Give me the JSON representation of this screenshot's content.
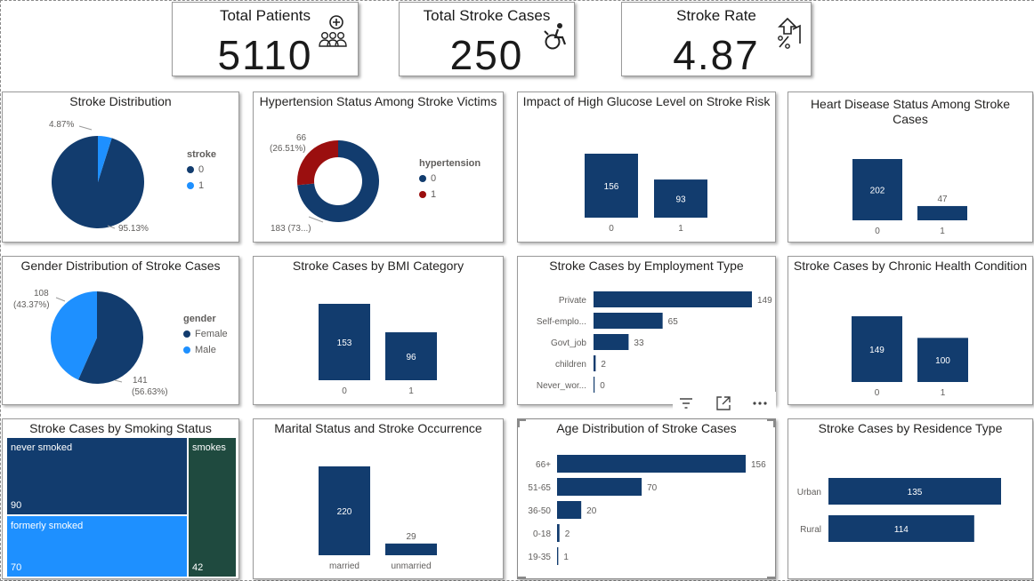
{
  "kpis": [
    {
      "title": "Total Patients",
      "value": "5110",
      "icon": "hospital-patients-icon"
    },
    {
      "title": "Total Stroke Cases",
      "value": "250",
      "icon": "wheelchair-icon"
    },
    {
      "title": "Stroke Rate",
      "value": "4.87",
      "icon": "percent-arrow-up-icon"
    }
  ],
  "colors": {
    "navy": "#123c6e",
    "light_blue": "#1e90ff",
    "dark_red": "#9b0f0f",
    "dark_green": "#1f4a3f"
  },
  "toolbar": {
    "icons": [
      "filter-icon",
      "focus-mode-icon",
      "more-options-icon"
    ]
  },
  "chart_data": [
    {
      "id": "stroke_distribution",
      "type": "pie",
      "title": "Stroke Distribution",
      "legend_title": "stroke",
      "categories": [
        "0",
        "1"
      ],
      "values": [
        95.13,
        4.87
      ],
      "labels": [
        "95.13%",
        "4.87%"
      ],
      "colors": [
        "#123c6e",
        "#1e90ff"
      ]
    },
    {
      "id": "hypertension",
      "type": "pie",
      "donut": true,
      "title": "Hypertension Status Among Stroke Victims",
      "legend_title": "hypertension",
      "categories": [
        "0",
        "1"
      ],
      "values": [
        183,
        66
      ],
      "labels": [
        "183 (73...)",
        "66",
        "(26.51%)"
      ],
      "colors": [
        "#123c6e",
        "#9b0f0f"
      ]
    },
    {
      "id": "glucose",
      "type": "bar",
      "title": "Impact of High Glucose Level on Stroke Risk",
      "categories": [
        "0",
        "1"
      ],
      "values": [
        156,
        93
      ]
    },
    {
      "id": "heart_disease",
      "type": "bar",
      "title": "Heart Disease Status Among Stroke Cases",
      "categories": [
        "0",
        "1"
      ],
      "values": [
        202,
        47
      ]
    },
    {
      "id": "gender",
      "type": "pie",
      "title": "Gender Distribution of Stroke Cases",
      "legend_title": "gender",
      "categories": [
        "Female",
        "Male"
      ],
      "values": [
        141,
        108
      ],
      "labels": [
        "141",
        "(56.63%)",
        "108",
        "(43.37%)"
      ],
      "colors": [
        "#123c6e",
        "#1e90ff"
      ]
    },
    {
      "id": "bmi",
      "type": "bar",
      "title": "Stroke Cases by BMI Category",
      "categories": [
        "0",
        "1"
      ],
      "values": [
        153,
        96
      ]
    },
    {
      "id": "employment",
      "type": "bar",
      "orientation": "horizontal",
      "title": "Stroke Cases by Employment Type",
      "categories": [
        "Private",
        "Self-emplo...",
        "Govt_job",
        "children",
        "Never_wor..."
      ],
      "values": [
        149,
        65,
        33,
        2,
        0
      ]
    },
    {
      "id": "chronic",
      "type": "bar",
      "title": "Stroke Cases by Chronic Health Condition",
      "categories": [
        "0",
        "1"
      ],
      "values": [
        149,
        100
      ]
    },
    {
      "id": "smoking",
      "type": "treemap",
      "title": "Stroke Cases by Smoking Status",
      "categories": [
        "never smoked",
        "formerly smoked",
        "smokes"
      ],
      "values": [
        90,
        70,
        42
      ],
      "colors": [
        "#123c6e",
        "#1e90ff",
        "#1f4a3f"
      ]
    },
    {
      "id": "marital",
      "type": "bar",
      "title": "Marital Status and Stroke Occurrence",
      "categories": [
        "married",
        "unmarried"
      ],
      "values": [
        220,
        29
      ]
    },
    {
      "id": "age",
      "type": "bar",
      "orientation": "horizontal",
      "title": "Age Distribution of Stroke Cases",
      "categories": [
        "66+",
        "51-65",
        "36-50",
        "0-18",
        "19-35"
      ],
      "values": [
        156,
        70,
        20,
        2,
        1
      ]
    },
    {
      "id": "residence",
      "type": "bar",
      "orientation": "horizontal",
      "title": "Stroke Cases by Residence Type",
      "categories": [
        "Urban",
        "Rural"
      ],
      "values": [
        135,
        114
      ]
    }
  ]
}
